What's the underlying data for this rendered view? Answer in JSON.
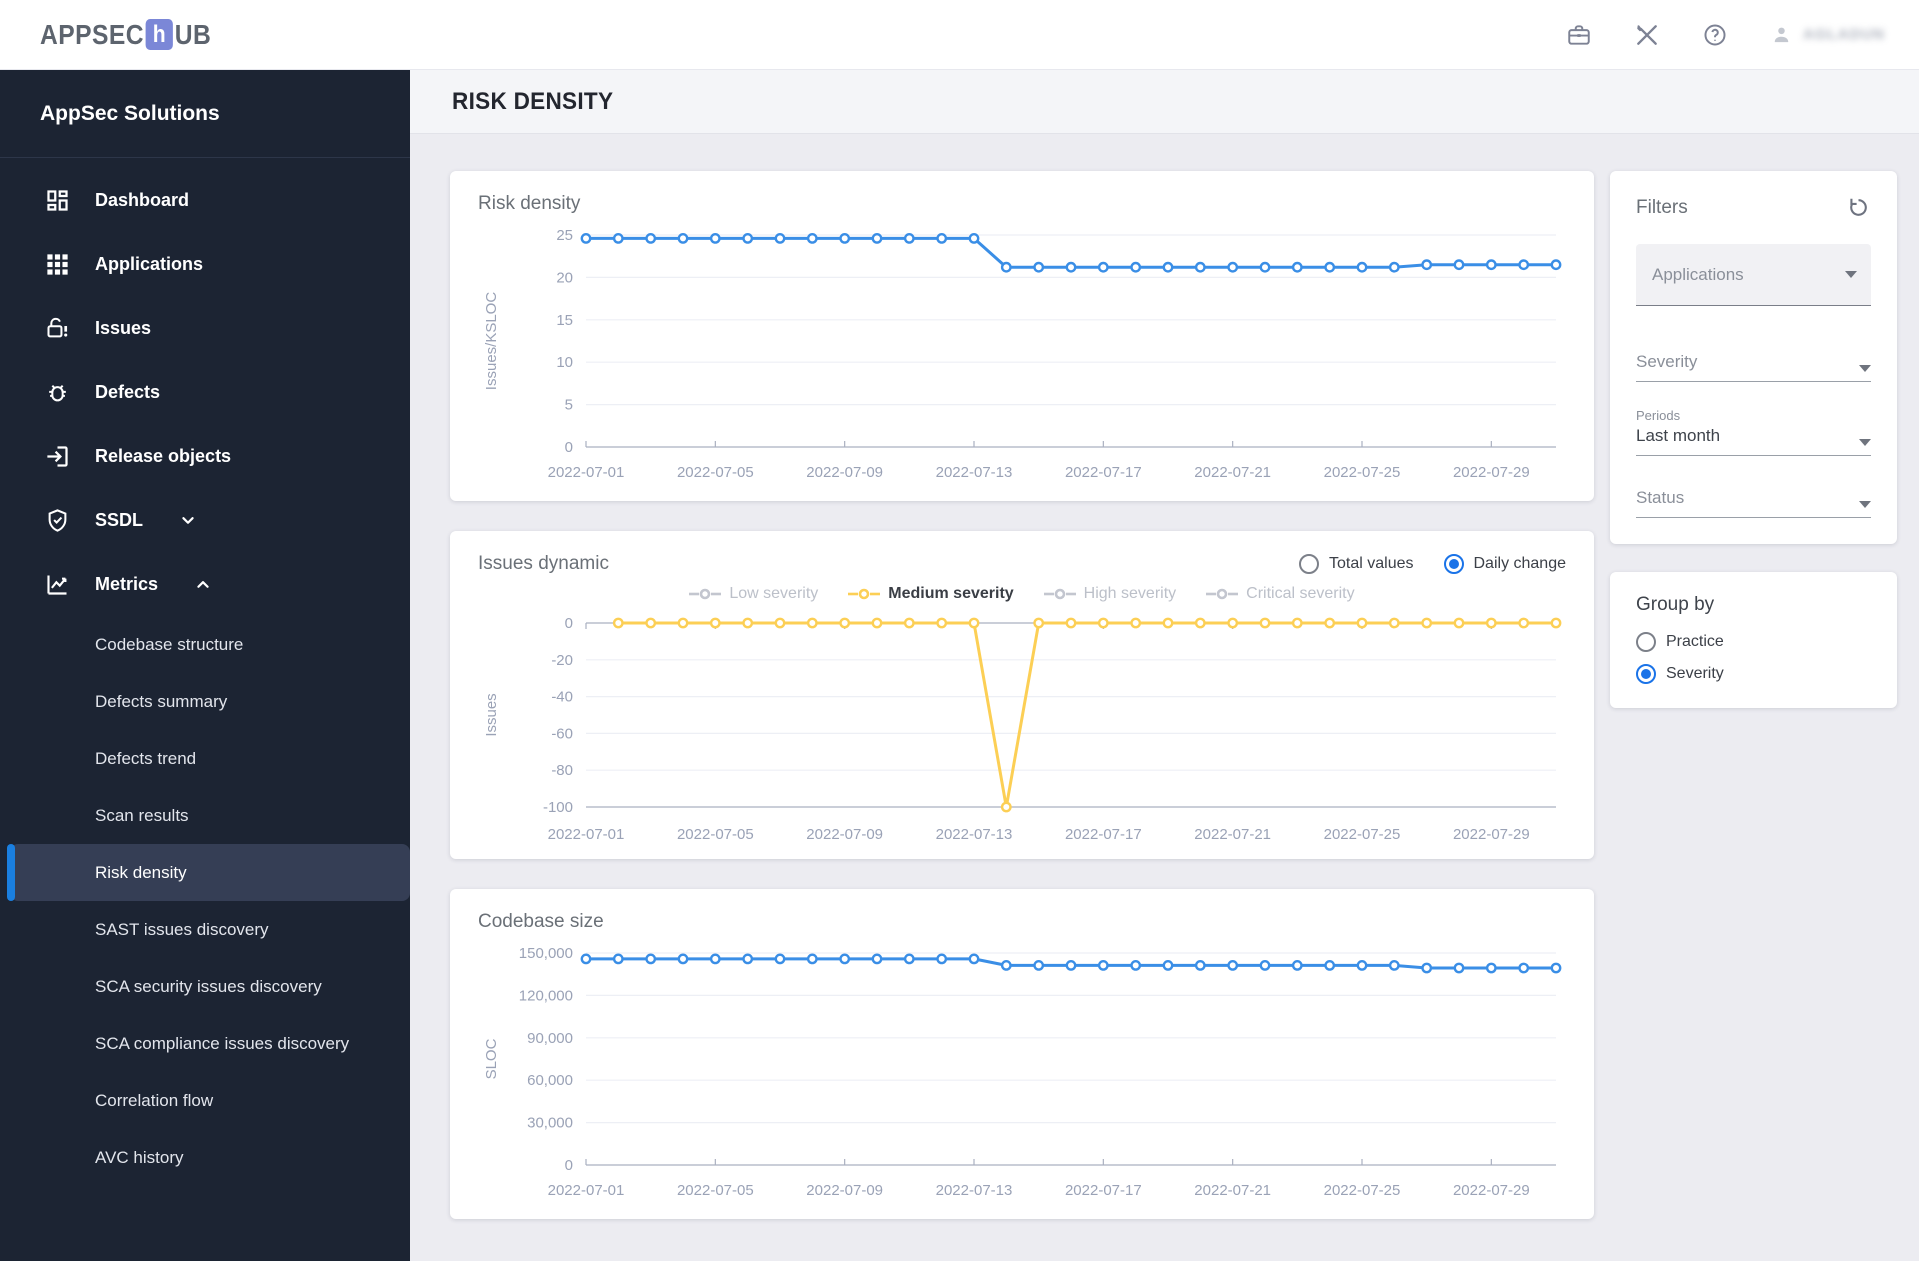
{
  "header": {
    "logo_prefix": "APPSEC",
    "logo_accent": "h",
    "logo_suffix": "UB",
    "username": "AGLADUN",
    "icons": [
      "briefcase-icon",
      "tools-icon",
      "help-icon",
      "user-icon"
    ]
  },
  "page": {
    "title": "RISK DENSITY"
  },
  "sidebar": {
    "title": "AppSec Solutions",
    "items": [
      {
        "type": "main",
        "label": "Dashboard",
        "icon": "dashboard-icon"
      },
      {
        "type": "main",
        "label": "Applications",
        "icon": "applications-icon"
      },
      {
        "type": "main",
        "label": "Issues",
        "icon": "issues-icon"
      },
      {
        "type": "main",
        "label": "Defects",
        "icon": "defects-icon"
      },
      {
        "type": "main",
        "label": "Release objects",
        "icon": "release-objects-icon"
      },
      {
        "type": "main",
        "label": "SSDL",
        "icon": "ssdl-icon",
        "chevron": "down"
      },
      {
        "type": "main",
        "label": "Metrics",
        "icon": "metrics-icon",
        "chevron": "up"
      },
      {
        "type": "sub",
        "label": "Codebase structure"
      },
      {
        "type": "sub",
        "label": "Defects summary"
      },
      {
        "type": "sub",
        "label": "Defects trend"
      },
      {
        "type": "sub",
        "label": "Scan results"
      },
      {
        "type": "sub",
        "label": "Risk density",
        "selected": true
      },
      {
        "type": "sub",
        "label": "SAST issues discovery"
      },
      {
        "type": "sub",
        "label": "SCA security issues discovery"
      },
      {
        "type": "sub",
        "label": "SCA compliance issues discovery"
      },
      {
        "type": "sub",
        "label": "Correlation flow"
      },
      {
        "type": "sub",
        "label": "AVC history"
      }
    ]
  },
  "filters": {
    "title": "Filters",
    "reset_icon": "reset-icon",
    "fields": [
      {
        "label": "Applications",
        "type": "filled-select"
      },
      {
        "label": "Severity",
        "type": "select"
      },
      {
        "label": "Periods",
        "value": "Last month",
        "type": "select"
      },
      {
        "label": "Status",
        "type": "select"
      }
    ]
  },
  "group_by": {
    "title": "Group by",
    "options": [
      {
        "label": "Practice",
        "selected": false
      },
      {
        "label": "Severity",
        "selected": true
      }
    ]
  },
  "colors": {
    "accent_blue": "#1a7fe0",
    "chart_blue": "#3a8ee6",
    "chart_yellow": "#fccf55",
    "sidebar_bg": "#1c2433"
  },
  "chart_meta": {
    "days": [
      "2022-07-01",
      "2022-07-02",
      "2022-07-03",
      "2022-07-04",
      "2022-07-05",
      "2022-07-06",
      "2022-07-07",
      "2022-07-08",
      "2022-07-09",
      "2022-07-10",
      "2022-07-11",
      "2022-07-12",
      "2022-07-13",
      "2022-07-14",
      "2022-07-15",
      "2022-07-16",
      "2022-07-17",
      "2022-07-18",
      "2022-07-19",
      "2022-07-20",
      "2022-07-21",
      "2022-07-22",
      "2022-07-23",
      "2022-07-24",
      "2022-07-25",
      "2022-07-26",
      "2022-07-27",
      "2022-07-28",
      "2022-07-29",
      "2022-07-30",
      "2022-07-31"
    ],
    "x_tick_indices": [
      0,
      4,
      8,
      12,
      16,
      20,
      24,
      28
    ],
    "x_tick_labels": [
      "2022-07-01",
      "2022-07-05",
      "2022-07-09",
      "2022-07-13",
      "2022-07-17",
      "2022-07-21",
      "2022-07-25",
      "2022-07-29"
    ]
  },
  "chart_data": [
    {
      "id": "risk-density",
      "type": "line",
      "title": "Risk density",
      "ylabel": "Issues/KSLOC",
      "ylim": [
        0,
        25
      ],
      "y_ticks": [
        0,
        5,
        10,
        15,
        20,
        25
      ],
      "y_tick_labels": [
        "0",
        "5",
        "10",
        "15",
        "20",
        "25"
      ],
      "x_axis_at": 0,
      "dark_lines": [
        0
      ],
      "grid": true,
      "series": [
        {
          "name": "Issues/KSLOC",
          "color": "#3a8ee6",
          "values": [
            24.6,
            24.6,
            24.6,
            24.6,
            24.6,
            24.6,
            24.6,
            24.6,
            24.6,
            24.6,
            24.6,
            24.6,
            24.6,
            21.2,
            21.2,
            21.2,
            21.2,
            21.2,
            21.2,
            21.2,
            21.2,
            21.2,
            21.2,
            21.2,
            21.2,
            21.2,
            21.5,
            21.5,
            21.5,
            21.5,
            21.5
          ]
        }
      ]
    },
    {
      "id": "issues-dynamic",
      "type": "line",
      "title": "Issues dynamic",
      "ylabel": "Issues",
      "ylim": [
        -100,
        0
      ],
      "y_ticks": [
        0,
        -20,
        -40,
        -60,
        -80,
        -100
      ],
      "y_tick_labels": [
        "0",
        "-20",
        "-40",
        "-60",
        "-80",
        "-100"
      ],
      "x_axis_at": 0,
      "dark_lines": [
        0,
        -100
      ],
      "grid": true,
      "controls": {
        "options": [
          {
            "label": "Total values",
            "selected": false
          },
          {
            "label": "Daily change",
            "selected": true
          }
        ]
      },
      "legend": [
        {
          "label": "Low severity",
          "color": "#c3c6cf",
          "active": false
        },
        {
          "label": "Medium severity",
          "color": "#fccf55",
          "active": true
        },
        {
          "label": "High severity",
          "color": "#c3c6cf",
          "active": false
        },
        {
          "label": "Critical severity",
          "color": "#c3c6cf",
          "active": false
        }
      ],
      "legend_position": "top-center",
      "series": [
        {
          "name": "Medium severity",
          "color": "#fccf55",
          "start_index": 1,
          "values": [
            0,
            0,
            0,
            0,
            0,
            0,
            0,
            0,
            0,
            0,
            0,
            0,
            -100,
            0,
            0,
            0,
            0,
            0,
            0,
            0,
            0,
            0,
            0,
            0,
            0,
            0,
            0,
            0,
            0,
            0
          ]
        }
      ]
    },
    {
      "id": "codebase-size",
      "type": "line",
      "title": "Codebase size",
      "ylabel": "SLOC",
      "ylim": [
        0,
        150000
      ],
      "y_ticks": [
        0,
        30000,
        60000,
        90000,
        120000,
        150000
      ],
      "y_tick_labels": [
        "0",
        "30,000",
        "60,000",
        "90,000",
        "120,000",
        "150,000"
      ],
      "x_axis_at": 0,
      "dark_lines": [
        0
      ],
      "grid": true,
      "series": [
        {
          "name": "SLOC",
          "color": "#3a8ee6",
          "values": [
            145800,
            145800,
            145800,
            145800,
            145800,
            145800,
            145800,
            145800,
            145800,
            145800,
            145800,
            145800,
            145800,
            141200,
            141200,
            141200,
            141200,
            141200,
            141200,
            141200,
            141200,
            141200,
            141200,
            141200,
            141200,
            141200,
            139400,
            139400,
            139400,
            139400,
            139400
          ]
        }
      ]
    }
  ]
}
